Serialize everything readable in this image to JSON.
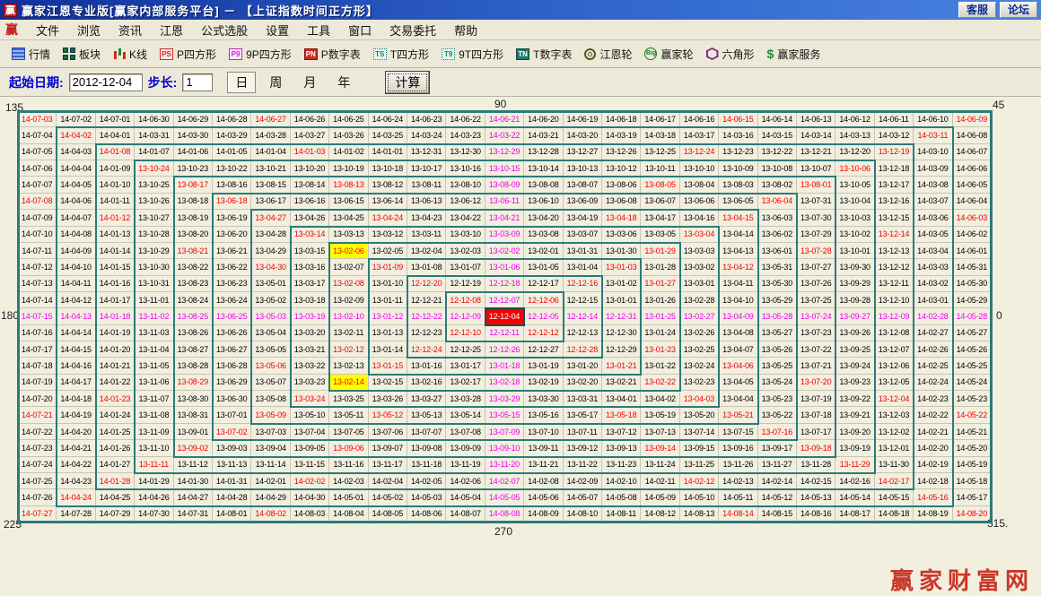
{
  "window": {
    "title": "赢家江恩专业版[赢家内部服务平台] － 【上证指数时间正方形】",
    "logo_char": "赢",
    "buttons": [
      "客服",
      "论坛"
    ]
  },
  "menu": {
    "logo_char": "赢",
    "items": [
      "文件",
      "浏览",
      "资讯",
      "江恩",
      "公式选股",
      "设置",
      "工具",
      "窗口",
      "交易委托",
      "帮助"
    ]
  },
  "toolbar": {
    "items": [
      {
        "icon": "quotes-table-icon",
        "label": "行情"
      },
      {
        "icon": "blocks-icon",
        "label": "板块"
      },
      {
        "icon": "kline-icon",
        "label": "K线"
      },
      {
        "icon": "ps-icon",
        "icon_text": "PS",
        "label": "P四方形"
      },
      {
        "icon": "p9-icon",
        "icon_text": "P9",
        "label": "9P四方形"
      },
      {
        "icon": "pn-icon",
        "icon_text": "PN",
        "label": "P数字表"
      },
      {
        "icon": "ts-icon",
        "icon_text": "TS",
        "label": "T四方形"
      },
      {
        "icon": "t9-icon",
        "icon_text": "T9",
        "label": "9T四方形"
      },
      {
        "icon": "tn-icon",
        "icon_text": "TN",
        "label": "T数字表"
      },
      {
        "icon": "gann-wheel-icon",
        "label": "江恩轮"
      },
      {
        "icon": "winner-wheel-icon",
        "icon_text": "Big",
        "label": "赢家轮"
      },
      {
        "icon": "hexagon-icon",
        "label": "六角形"
      },
      {
        "icon": "dollar-icon",
        "icon_text": "$",
        "label": "赢家服务"
      }
    ]
  },
  "controls": {
    "start_label": "起始日期:",
    "start_value": "2012-12-04",
    "step_label": "步长:",
    "step_value": "1",
    "periods": [
      "日",
      "周",
      "月",
      "年"
    ],
    "selected_period": "日",
    "calc_label": "计算"
  },
  "degree_labels": {
    "top_left": "135",
    "top_center": "90",
    "top_right": "45",
    "left": "180",
    "right": "0",
    "bottom_left": "225",
    "bottom_center": "270",
    "bottom_right": "315."
  },
  "watermark": "赢家财富网",
  "chart_data": {
    "type": "gann-time-square-spiral",
    "instrument": "上证指数",
    "start_date": "2012-12-04",
    "center_label": "12-12-04",
    "step_days": 1,
    "rings": 12,
    "grid_cols": 25,
    "grid_rows": 25,
    "spiral_direction": "counterclockwise-start-east",
    "date_format": "YY-MM-DD",
    "corner_dates": {
      "top_left": "14-07-03",
      "top_right": "14-06-09",
      "bottom_left": "14-07-27",
      "bottom_right": "14-08-20"
    },
    "colors": {
      "default_text": "#000000",
      "axis_text": "#ee00ee",
      "highlight_text": "#f40000",
      "yellow_bg": "#ffff00",
      "center_bg": "#f40000",
      "center_text": "#ffffff",
      "ring_border": "#2a7b7b",
      "canvas_bg": "#f2efdf"
    },
    "highlight_rules": {
      "axis_cells": "magenta on horizontal/vertical center lines",
      "diagonal_cells": "red on 45-degree diagonals",
      "ray_cells": "red where |x|=2|y| or |y|=2|x| on even rings >= 4"
    },
    "yellow_dates": [
      "13-02-06",
      "13-02-14"
    ],
    "red_extra_dates": [
      "14-01-12",
      "14-07-08"
    ],
    "red_suppressed_dates": [
      "13-01-31",
      "13-02-04",
      "13-02-16",
      "13-02-20",
      "14-01-13",
      "14-07-09"
    ]
  }
}
